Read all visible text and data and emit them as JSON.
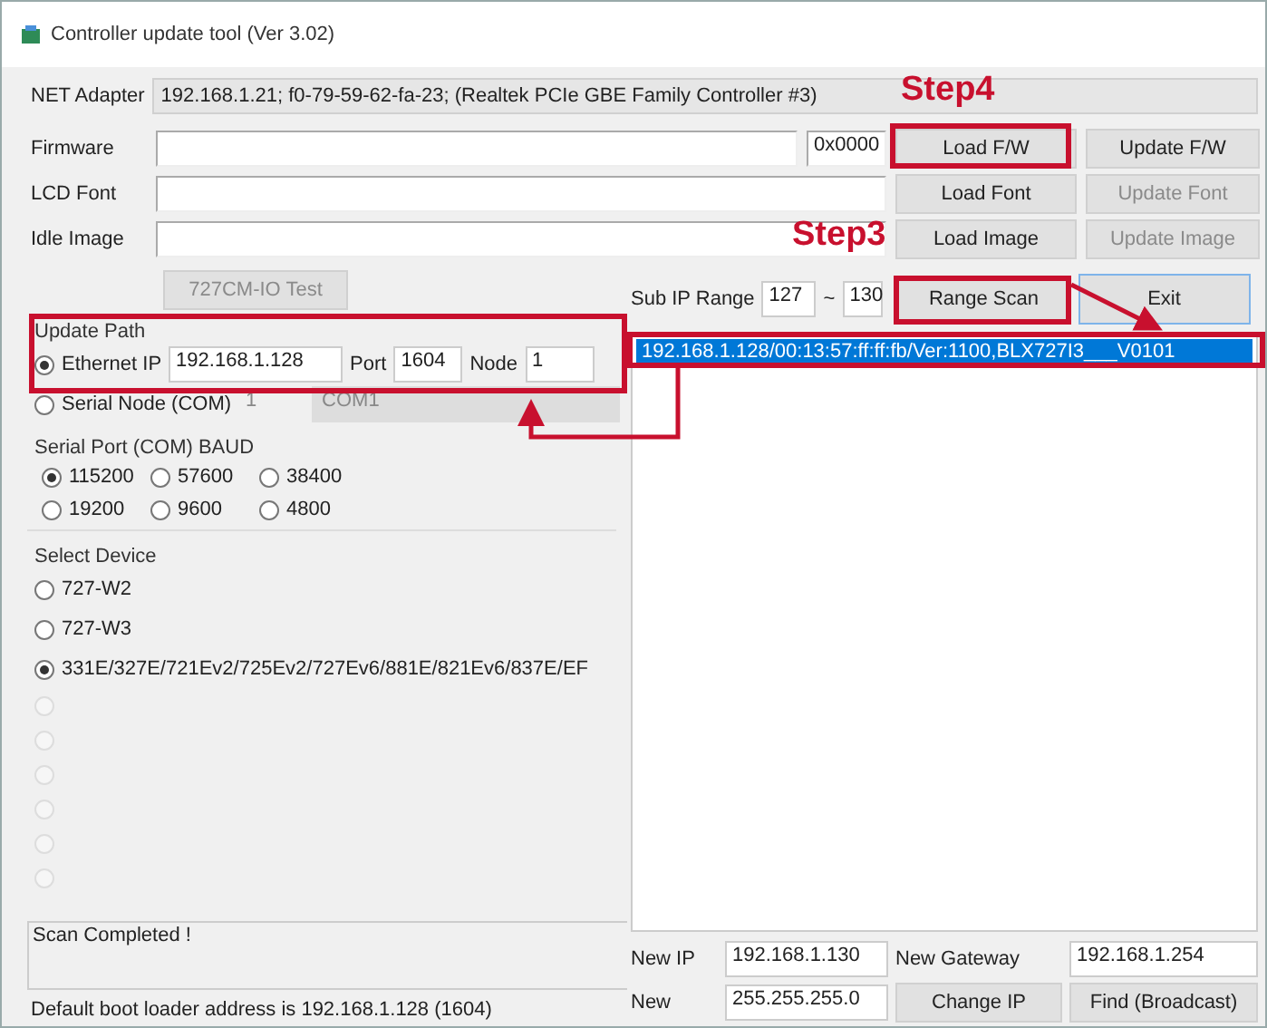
{
  "window": {
    "title": "Controller update tool  (Ver 3.02)"
  },
  "net_adapter": {
    "label": "NET Adapter",
    "value": "192.168.1.21;  f0-79-59-62-fa-23;  (Realtek PCIe GBE Family Controller #3)"
  },
  "files": [
    {
      "label": "Firmware",
      "hex": "0x0000",
      "load_button": "Load F/W",
      "update_button": "Update F/W",
      "update_disabled": false
    },
    {
      "label": "LCD Font",
      "load_button": "Load Font",
      "update_button": "Update Font",
      "update_disabled": true
    },
    {
      "label": "Idle Image",
      "load_button": "Load Image",
      "update_button": "Update Image",
      "update_disabled": true
    }
  ],
  "test_button": {
    "label": "727CM-IO Test",
    "disabled": true
  },
  "update_path": {
    "title": "Update Path",
    "ethernet": {
      "label": "Ethernet IP",
      "selected": true,
      "ip": "192.168.1.128",
      "port_label": "Port",
      "port": "1604",
      "node_label": "Node",
      "node": "1"
    },
    "serial": {
      "label": "Serial Node (COM)",
      "selected": false,
      "node": "1",
      "com": "COM1"
    }
  },
  "baud": {
    "title": "Serial Port (COM) BAUD",
    "options": [
      {
        "label": "115200",
        "selected": true
      },
      {
        "label": "57600",
        "selected": false
      },
      {
        "label": "38400",
        "selected": false
      },
      {
        "label": "19200",
        "selected": false
      },
      {
        "label": "9600",
        "selected": false
      },
      {
        "label": "4800",
        "selected": false
      }
    ]
  },
  "devices": {
    "title": "Select Device",
    "items": [
      {
        "label": "727-W2",
        "selected": false,
        "disabled": false
      },
      {
        "label": "727-W3",
        "selected": false,
        "disabled": false
      },
      {
        "label": "331E/327E/721Ev2/725Ev2/727Ev6/881E/821Ev6/837E/EF",
        "selected": true,
        "disabled": false
      },
      {
        "selected": false,
        "disabled": true
      },
      {
        "selected": false,
        "disabled": true
      },
      {
        "selected": false,
        "disabled": true
      },
      {
        "selected": false,
        "disabled": true
      },
      {
        "selected": false,
        "disabled": true
      },
      {
        "selected": false,
        "disabled": true
      }
    ]
  },
  "status": {
    "message": "Scan Completed !",
    "note": "Default boot loader address is 192.168.1.128 (1604)"
  },
  "scan": {
    "label": "Sub IP Range",
    "from": "127",
    "separator": "~",
    "to": "130",
    "scan_button": "Range Scan",
    "exit_button": "Exit"
  },
  "found_devices": [
    {
      "text": "192.168.1.128/00:13:57:ff:ff:fb/Ver:1100,BLX727I3___V0101",
      "selected": true
    }
  ],
  "new_ip": {
    "ip_label": "New IP",
    "ip": "192.168.1.130",
    "gateway_label": "New Gateway",
    "gateway": "192.168.1.254",
    "mask_label": "New",
    "mask": "255.255.255.0",
    "change_button": "Change IP",
    "find_button": "Find (Broadcast)"
  },
  "annotations": [
    {
      "text": "Step4"
    },
    {
      "text": "Step3"
    }
  ]
}
